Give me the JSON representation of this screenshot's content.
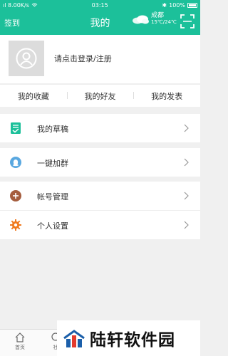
{
  "status_bar": {
    "signal": "ıl 8.00K/s",
    "time": "03:15",
    "battery": "100%"
  },
  "header": {
    "checkin": "签到",
    "title": "我的",
    "city": "成都",
    "temp": "15℃/24℃",
    "weather_icon": "cloud-icon",
    "scan_icon": "scan-icon"
  },
  "profile": {
    "login": "请点击登录/注册",
    "avatar_icon": "user-avatar-icon"
  },
  "tabs": [
    "我的收藏",
    "我的好友",
    "我的发表"
  ],
  "menu": [
    {
      "label": "我的草稿",
      "icon": "draft-icon",
      "color": "#1cc09a"
    },
    {
      "label": "一键加群",
      "icon": "qq-icon",
      "color": "#5aa8e0"
    },
    {
      "label": "帐号管理",
      "icon": "plus-circle-icon",
      "color": "#a55d3e"
    },
    {
      "label": "个人设置",
      "icon": "gear-icon",
      "color": "#f07a1f"
    }
  ],
  "bottom_nav": [
    {
      "label": "首页"
    },
    {
      "label": "社"
    }
  ],
  "watermark": {
    "text": "陆轩软件园"
  },
  "colors": {
    "accent": "#1cc09a"
  }
}
